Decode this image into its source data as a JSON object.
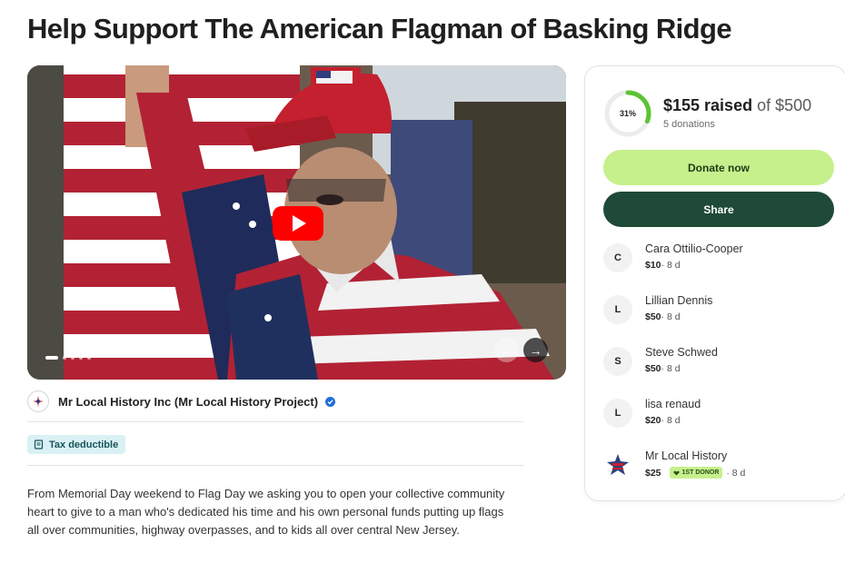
{
  "page": {
    "title": "Help Support The American Flagman of Basking Ridge"
  },
  "media": {
    "play_icon": "youtube-play-icon",
    "prev_icon": "←",
    "next_icon": "→",
    "slide_count": 5,
    "active_slide": 1
  },
  "organizer": {
    "name": "Mr Local History Inc (Mr Local History Project)",
    "verified_icon": "verified-check-icon"
  },
  "tax": {
    "label": "Tax deductible"
  },
  "description": "From Memorial Day weekend to Flag Day we asking you to open your collective community heart to give to a man who's dedicated his time and his own personal funds putting up flags all over communities, highway overpasses, and to kids all over central New Jersey.",
  "fundraiser": {
    "percent": 31,
    "percent_label": "31%",
    "raised": "$155 raised",
    "goal": " of $500",
    "donations": "5 donations",
    "donate_label": "Donate now",
    "share_label": "Share"
  },
  "donors": [
    {
      "initial": "C",
      "name": "Cara Ottilio-Cooper",
      "amount": "$10",
      "time": " · 8 d"
    },
    {
      "initial": "L",
      "name": "Lillian Dennis",
      "amount": "$50",
      "time": " · 8 d"
    },
    {
      "initial": "S",
      "name": "Steve Schwed",
      "amount": "$50",
      "time": " · 8 d"
    },
    {
      "initial": "L",
      "name": "lisa renaud",
      "amount": "$20",
      "time": " · 8 d"
    },
    {
      "initial": "",
      "name": "Mr Local History",
      "amount": "$25",
      "badge": "1ST DONOR",
      "time": "· 8 d"
    }
  ],
  "colors": {
    "progress": "#5cc433",
    "donate_bg": "#c6f08c",
    "share_bg": "#1e4a37",
    "tax_bg": "#d9f1f4",
    "verified": "#1f6fd6",
    "play": "#ff0000"
  }
}
